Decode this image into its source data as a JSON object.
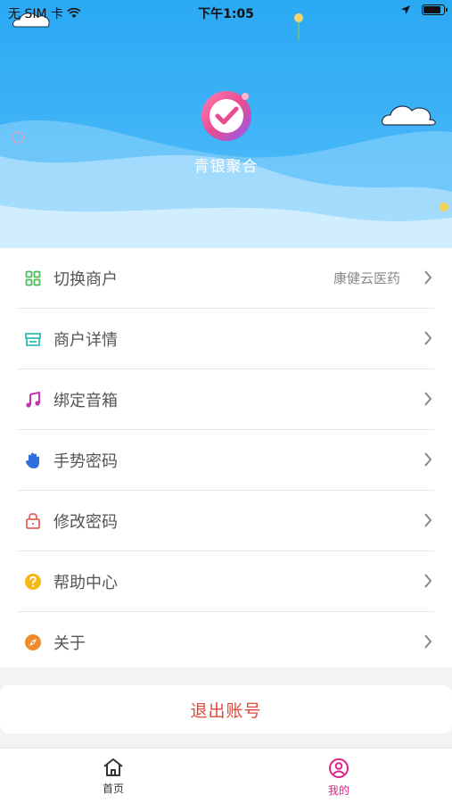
{
  "status_bar": {
    "carrier": "无 SIM 卡",
    "time": "下午1:05"
  },
  "header": {
    "app_name": "青银聚合",
    "logo_icon": "check-badge-logo",
    "background_color": "#2aa9f3"
  },
  "menu": {
    "items": [
      {
        "label": "切换商户",
        "value": "康健云医药",
        "icon": "grid-icon"
      },
      {
        "label": "商户详情",
        "icon": "store-icon"
      },
      {
        "label": "绑定音箱",
        "icon": "music-note-icon"
      },
      {
        "label": "手势密码",
        "icon": "hand-icon"
      },
      {
        "label": "修改密码",
        "icon": "lock-icon"
      },
      {
        "label": "帮助中心",
        "icon": "help-circle-icon"
      },
      {
        "label": "关于",
        "icon": "compass-icon"
      }
    ]
  },
  "logout": {
    "label": "退出账号",
    "color": "#e04a3b"
  },
  "tabbar": {
    "tabs": [
      {
        "label": "首页",
        "icon": "home-icon",
        "active": false
      },
      {
        "label": "我的",
        "icon": "user-icon",
        "active": true
      }
    ],
    "active_color": "#e0218a"
  }
}
